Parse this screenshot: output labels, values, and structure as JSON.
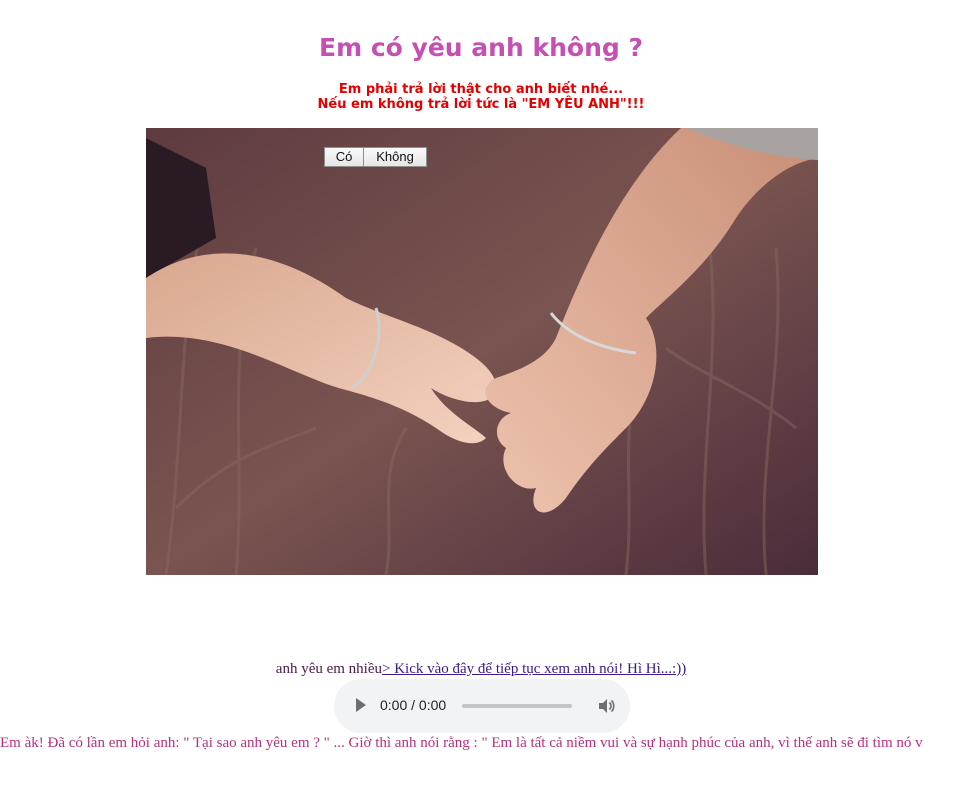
{
  "page": {
    "title": "Em có yêu anh không ?",
    "subtitle_line1": "Em phải trả lời thật cho anh biết nhé...",
    "subtitle_line2": "Nếu em không trả lời tức là \"EM YÊU ANH\"!!!"
  },
  "buttons": {
    "yes_label": "Có",
    "no_label": "Không"
  },
  "image": {
    "icon": "holding-hands-photo"
  },
  "footer": {
    "prefix_text": "anh yêu em nhiều",
    "link_text": "> Kick vào đây để tiếp tục xem anh nói! Hì Hì...:))",
    "marquee_text": "Em àk! Đã có lần em hỏi anh: \" Tại sao anh yêu em ? \" ... Giờ thì anh nói rằng : \" Em là tất cả niềm vui và sự hạnh phúc của anh, vì thế anh sẽ đi tìm nó v"
  },
  "audio_player": {
    "time_display": "0:00 / 0:00",
    "play_icon": "play-icon",
    "volume_icon": "volume-icon"
  },
  "colors": {
    "title": "#c54fb2",
    "subtitle": "#e20000",
    "marquee": "#b5327a"
  }
}
